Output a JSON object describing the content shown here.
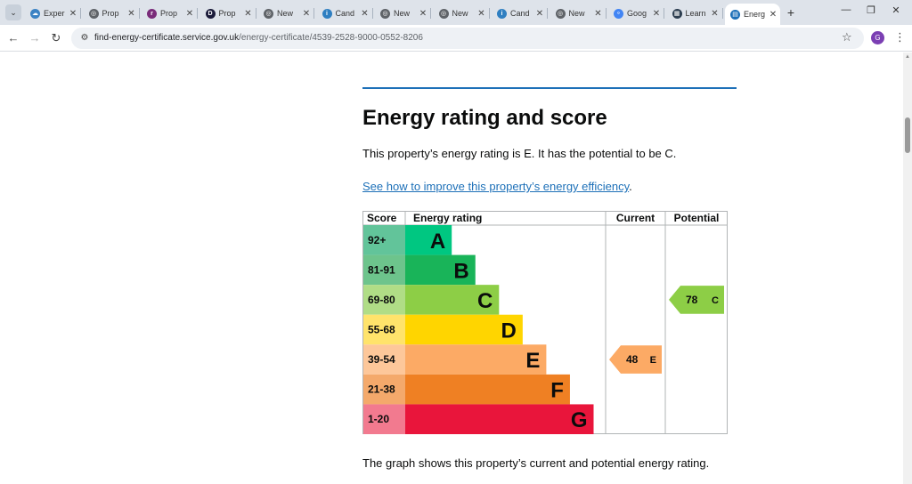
{
  "browser": {
    "tabs": [
      {
        "label": "Exper",
        "fav_color": "#3b82c4",
        "fav_glyph": "☁"
      },
      {
        "label": "Prop",
        "fav_color": "#5f6368",
        "fav_glyph": "◎"
      },
      {
        "label": "Prop",
        "fav_color": "#7a2c7a",
        "fav_glyph": "r"
      },
      {
        "label": "Prop",
        "fav_color": "#1b1b3a",
        "fav_glyph": "D"
      },
      {
        "label": "New",
        "fav_color": "#5f6368",
        "fav_glyph": "◎"
      },
      {
        "label": "Cand",
        "fav_color": "#2f7fc1",
        "fav_glyph": "i"
      },
      {
        "label": "New",
        "fav_color": "#5f6368",
        "fav_glyph": "◎"
      },
      {
        "label": "New",
        "fav_color": "#5f6368",
        "fav_glyph": "◎"
      },
      {
        "label": "Cand",
        "fav_color": "#2f7fc1",
        "fav_glyph": "i"
      },
      {
        "label": "New",
        "fav_color": "#5f6368",
        "fav_glyph": "◎"
      },
      {
        "label": "Goog",
        "fav_color": "#4285f4",
        "fav_glyph": "⚬"
      },
      {
        "label": "Learn",
        "fav_color": "#2d3e50",
        "fav_glyph": "▦"
      },
      {
        "label": "Energ",
        "fav_color": "#1d70b8",
        "fav_glyph": "▤",
        "active": true
      }
    ],
    "url_host": "find-energy-certificate.service.gov.uk",
    "url_path": "/energy-certificate/4539-2528-9000-0552-8206",
    "profile_initial": "G"
  },
  "content": {
    "heading": "Energy rating and score",
    "intro": "This property’s energy rating is E. It has the potential to be C.",
    "link_text": "See how to improve this property’s energy efficiency",
    "link_suffix": ".",
    "footer_text": "The graph shows this property’s current and potential energy rating."
  },
  "epc_chart": {
    "headers": {
      "score": "Score",
      "rating": "Energy rating",
      "current": "Current",
      "potential": "Potential"
    },
    "bands": [
      {
        "score": "92+",
        "letter": "A",
        "color": "#00c781",
        "score_bg": "#62c49a",
        "width_frac": 0.232
      },
      {
        "score": "81-91",
        "letter": "B",
        "color": "#19b459",
        "score_bg": "#6dc48c",
        "width_frac": 0.35
      },
      {
        "score": "69-80",
        "letter": "C",
        "color": "#8dce46",
        "score_bg": "#b0dd86",
        "width_frac": 0.468
      },
      {
        "score": "55-68",
        "letter": "D",
        "color": "#ffd500",
        "score_bg": "#ffe36b",
        "width_frac": 0.586
      },
      {
        "score": "39-54",
        "letter": "E",
        "color": "#fcaa65",
        "score_bg": "#fdc79a",
        "width_frac": 0.704
      },
      {
        "score": "21-38",
        "letter": "F",
        "color": "#ef8023",
        "score_bg": "#f4a96b",
        "width_frac": 0.822
      },
      {
        "score": "1-20",
        "letter": "G",
        "color": "#e9153b",
        "score_bg": "#f27a8f",
        "width_frac": 0.94
      }
    ],
    "current": {
      "score": "48",
      "letter": "E",
      "band_index": 4,
      "color": "#fcaa65"
    },
    "potential": {
      "score": "78",
      "letter": "C",
      "band_index": 2,
      "color": "#8dce46"
    }
  }
}
